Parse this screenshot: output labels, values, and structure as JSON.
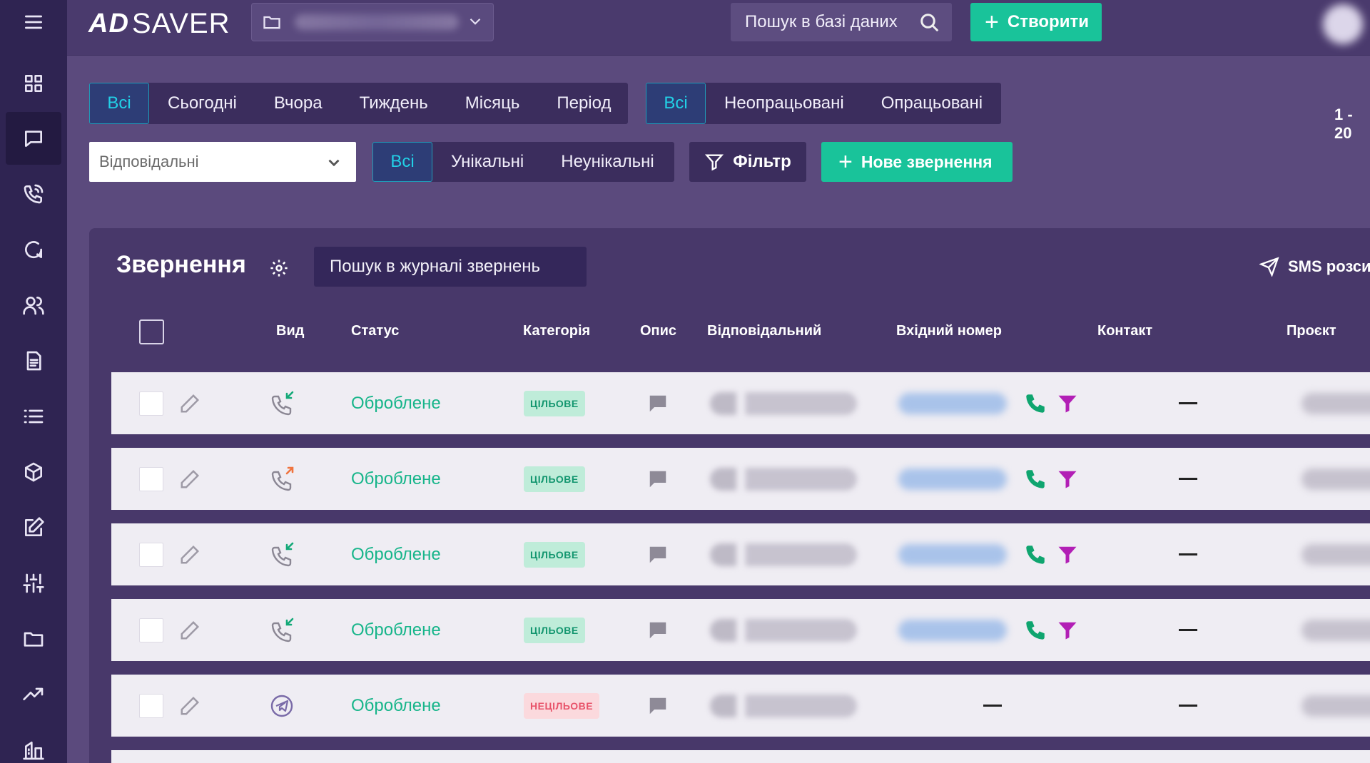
{
  "app": {
    "logo_mark": "AD",
    "logo_text": "SAVER"
  },
  "topbar": {
    "db_search_text": "Пошук в базі даних",
    "create_label": "Створити"
  },
  "period_tabs": [
    "Всі",
    "Сьогодні",
    "Вчора",
    "Тиждень",
    "Місяць",
    "Період"
  ],
  "process_tabs": [
    "Всі",
    "Неопрацьовані",
    "Опрацьовані"
  ],
  "unique_tabs": [
    "Всі",
    "Унікальні",
    "Неунікальні"
  ],
  "responsible_placeholder": "Відповідальні",
  "filter_label": "Фільтр",
  "new_request_label": "Нове звернення",
  "range_text": "1 - 20",
  "panel": {
    "title": "Звернення",
    "search_text": "Пошук в журналі звернень",
    "sms_label": "SMS розси"
  },
  "columns": [
    "Вид",
    "Статус",
    "Категорія",
    "Опис",
    "Відповідальний",
    "Вхідний номер",
    "Контакт",
    "Проєкт"
  ],
  "rows": [
    {
      "type": "incoming-call",
      "status": "Оброблене",
      "category": "ЦІЛЬОВЕ",
      "category_kind": "target",
      "has_phone": true,
      "contact": "—"
    },
    {
      "type": "outgoing-call",
      "status": "Оброблене",
      "category": "ЦІЛЬОВЕ",
      "category_kind": "target",
      "has_phone": true,
      "contact": "—"
    },
    {
      "type": "incoming-call",
      "status": "Оброблене",
      "category": "ЦІЛЬОВЕ",
      "category_kind": "target",
      "has_phone": true,
      "contact": "—"
    },
    {
      "type": "incoming-call",
      "status": "Оброблене",
      "category": "ЦІЛЬОВЕ",
      "category_kind": "target",
      "has_phone": true,
      "contact": "—"
    },
    {
      "type": "telegram",
      "status": "Оброблене",
      "category": "НЕЦІЛЬОВЕ",
      "category_kind": "nontarget",
      "has_phone": false,
      "incoming_number": "—",
      "contact": "—"
    }
  ],
  "colors": {
    "accent_green": "#19c39a",
    "active_tab_text": "#22d0e6",
    "status_green": "#17b58a",
    "funnel": "#b21fb5"
  }
}
